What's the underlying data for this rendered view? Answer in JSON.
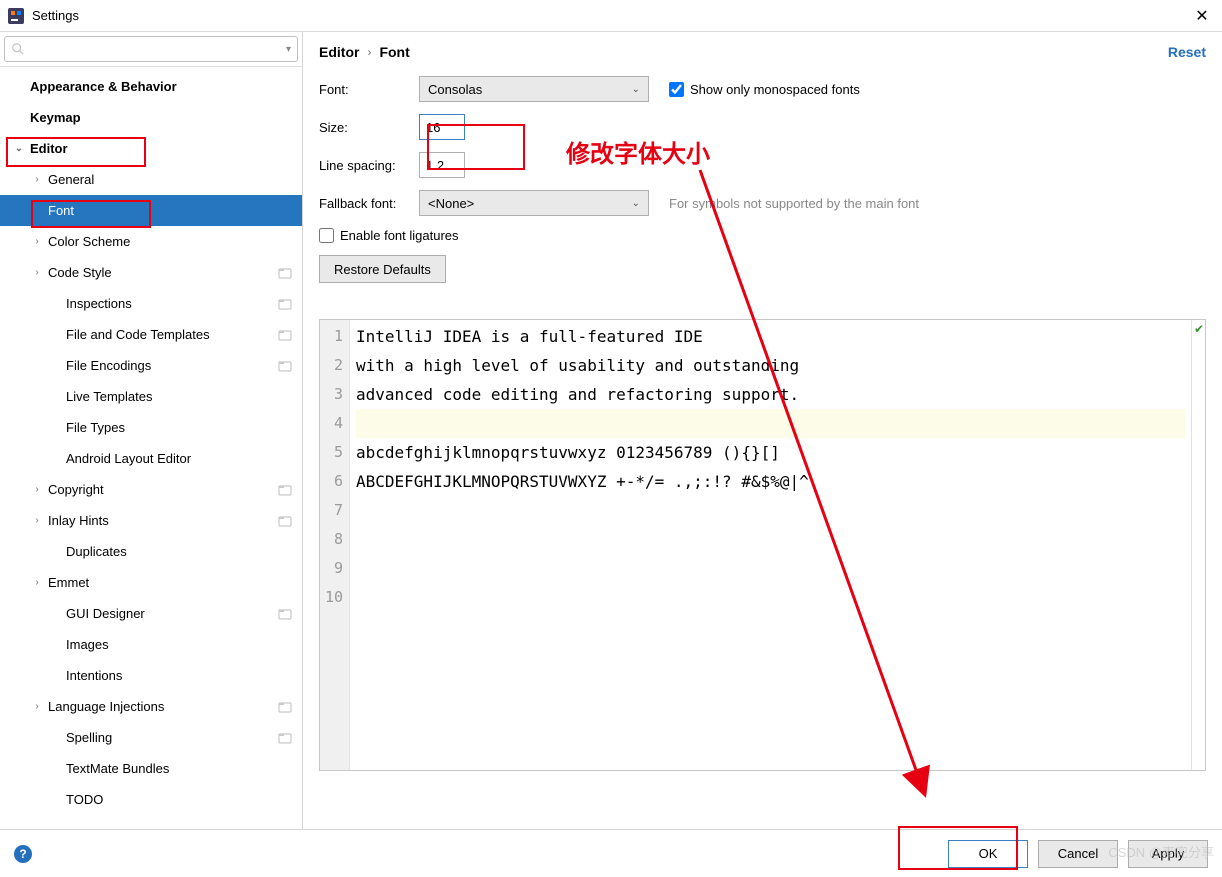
{
  "window": {
    "title": "Settings"
  },
  "sidebar": {
    "search_placeholder": "",
    "items": [
      {
        "label": "Appearance & Behavior",
        "depth": 0,
        "bold": true,
        "exp": ""
      },
      {
        "label": "Keymap",
        "depth": 0,
        "bold": true,
        "exp": ""
      },
      {
        "label": "Editor",
        "depth": 0,
        "bold": true,
        "exp": "down"
      },
      {
        "label": "General",
        "depth": 1,
        "bold": false,
        "exp": "right"
      },
      {
        "label": "Font",
        "depth": 1,
        "bold": false,
        "exp": "",
        "selected": true
      },
      {
        "label": "Color Scheme",
        "depth": 1,
        "bold": false,
        "exp": "right"
      },
      {
        "label": "Code Style",
        "depth": 1,
        "bold": false,
        "exp": "right",
        "proj": true
      },
      {
        "label": "Inspections",
        "depth": 2,
        "bold": false,
        "exp": "",
        "proj": true
      },
      {
        "label": "File and Code Templates",
        "depth": 2,
        "bold": false,
        "exp": "",
        "proj": true
      },
      {
        "label": "File Encodings",
        "depth": 2,
        "bold": false,
        "exp": "",
        "proj": true
      },
      {
        "label": "Live Templates",
        "depth": 2,
        "bold": false,
        "exp": ""
      },
      {
        "label": "File Types",
        "depth": 2,
        "bold": false,
        "exp": ""
      },
      {
        "label": "Android Layout Editor",
        "depth": 2,
        "bold": false,
        "exp": ""
      },
      {
        "label": "Copyright",
        "depth": 1,
        "bold": false,
        "exp": "right",
        "proj": true
      },
      {
        "label": "Inlay Hints",
        "depth": 1,
        "bold": false,
        "exp": "right",
        "proj": true
      },
      {
        "label": "Duplicates",
        "depth": 2,
        "bold": false,
        "exp": ""
      },
      {
        "label": "Emmet",
        "depth": 1,
        "bold": false,
        "exp": "right"
      },
      {
        "label": "GUI Designer",
        "depth": 2,
        "bold": false,
        "exp": "",
        "proj": true
      },
      {
        "label": "Images",
        "depth": 2,
        "bold": false,
        "exp": ""
      },
      {
        "label": "Intentions",
        "depth": 2,
        "bold": false,
        "exp": ""
      },
      {
        "label": "Language Injections",
        "depth": 1,
        "bold": false,
        "exp": "right",
        "proj": true
      },
      {
        "label": "Spelling",
        "depth": 2,
        "bold": false,
        "exp": "",
        "proj": true
      },
      {
        "label": "TextMate Bundles",
        "depth": 2,
        "bold": false,
        "exp": ""
      },
      {
        "label": "TODO",
        "depth": 2,
        "bold": false,
        "exp": ""
      }
    ]
  },
  "breadcrumb": {
    "a": "Editor",
    "b": "Font",
    "reset": "Reset"
  },
  "form": {
    "font_label": "Font:",
    "font_value": "Consolas",
    "show_mono_label": "Show only monospaced fonts",
    "show_mono_checked": true,
    "size_label": "Size:",
    "size_value": "16",
    "spacing_label": "Line spacing:",
    "spacing_value": "1.2",
    "fallback_label": "Fallback font:",
    "fallback_value": "<None>",
    "fallback_hint": "For symbols not supported by the main font",
    "ligatures_label": "Enable font ligatures",
    "ligatures_checked": false,
    "restore": "Restore Defaults"
  },
  "preview": {
    "lines": [
      "IntelliJ IDEA is a full-featured IDE",
      "with a high level of usability and outstanding",
      "advanced code editing and refactoring support.",
      "",
      "abcdefghijklmnopqrstuvwxyz 0123456789 (){}[]",
      "ABCDEFGHIJKLMNOPQRSTUVWXYZ +-*/= .,;:!? #&$%@|^",
      "",
      "",
      "",
      ""
    ]
  },
  "footer": {
    "ok": "OK",
    "cancel": "Cancel",
    "apply": "Apply"
  },
  "annotation": {
    "text": "修改字体大小"
  },
  "watermark": "CSDN @麦兜分享"
}
